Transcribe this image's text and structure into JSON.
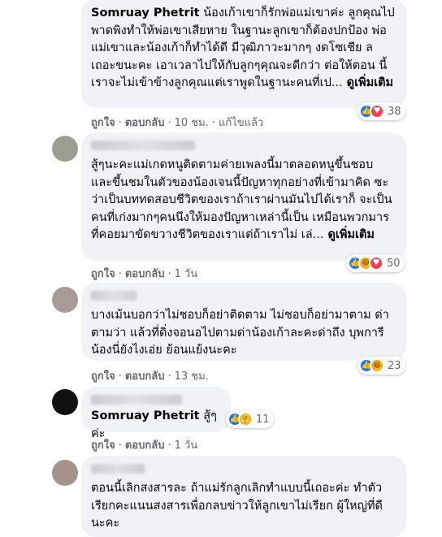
{
  "comments": [
    {
      "author": "Somruay Phetrit",
      "text": " น้องเก้าเขาก็รักพ่อแม่เขาค่ะ ลูกคุณไป พาดพิงทำให้พ่อเขาเสียหาย ในฐานะลูกเขาก็ต้องปกป้อง พ่อแม่เขาและน้องเก้าก็ทำได้ดี มีวุฒิภาวะมากๆ งดโซเชีย ลเถอะขนะคะ เอาเวลาไปให้กับลูกๆคุณจะดีกว่า ต่อให้ตอน นี้เราจะไม่เข้าข้างลูกคุณแต่เราพูดในฐานะคนที่เป...",
      "more": " ดูเพิ่มเติม",
      "like": "ถูกใจ",
      "reply": "ตอบกลับ",
      "time": "10 ชม.",
      "edited": "แก้ไขแล้ว",
      "reaction_count": "38"
    },
    {
      "text": "สู้ๆนะคะแม่เกดหนูติดตามค่ายเพลงนี้มาตลอดหนูขึ้นชอบ และขึ้นชมในตัวของน้องเจนนี้ปัญหาทุกอย่างที่เข้ามาคิด ซะว่าเป็นบททดสอบชีวิตของเราถ้าเราผ่านมันไปได้เราก็ จะเป็นคนที่เก่งมากๆคนนึงให้มองปัญหาเหล่านี้เป็น เหมือนพวกมารที่คอยมาขัดขวางชีวิตของเราแต่ถ้าเราไม่ เล่...",
      "more": " ดูเพิ่มเติม",
      "like": "ถูกใจ",
      "reply": "ตอบกลับ",
      "time": "1 วัน",
      "reaction_count": "50"
    },
    {
      "text": "บางเม้นบอกว่าไม่ชอบก็อย่าติดตาม ไม่ชอบก็อย่ามาตาม ด่าตามว่า แล้วที่ดิ่งจอนอไปตามด่าน้องเก้าละคะด่าถึง บุพการีน้องนี่ยังไงเอ่ย ย้อนแย้งนะคะ",
      "like": "ถูกใจ",
      "reply": "ตอบกลับ",
      "time": "13 ชม.",
      "reaction_count": "23"
    },
    {
      "author": "Somruay Phetrit",
      "text": " สู้ๆค่ะ",
      "like": "ถูกใจ",
      "reply": "ตอบกลับ",
      "time": "1 วัน",
      "reaction_count": "11"
    },
    {
      "text": "ตอนนี้เลิกสงสารละ ถ้าแม่รักลูกเลิกทำแบบนี้เถอะค่ะ ทำตัวเรียกคะแนนสงสารเพื่อกลบข่าวให้ลูกเขาไม่เรียก ผู้ใหญ่ที่ดีนะคะ"
    }
  ]
}
